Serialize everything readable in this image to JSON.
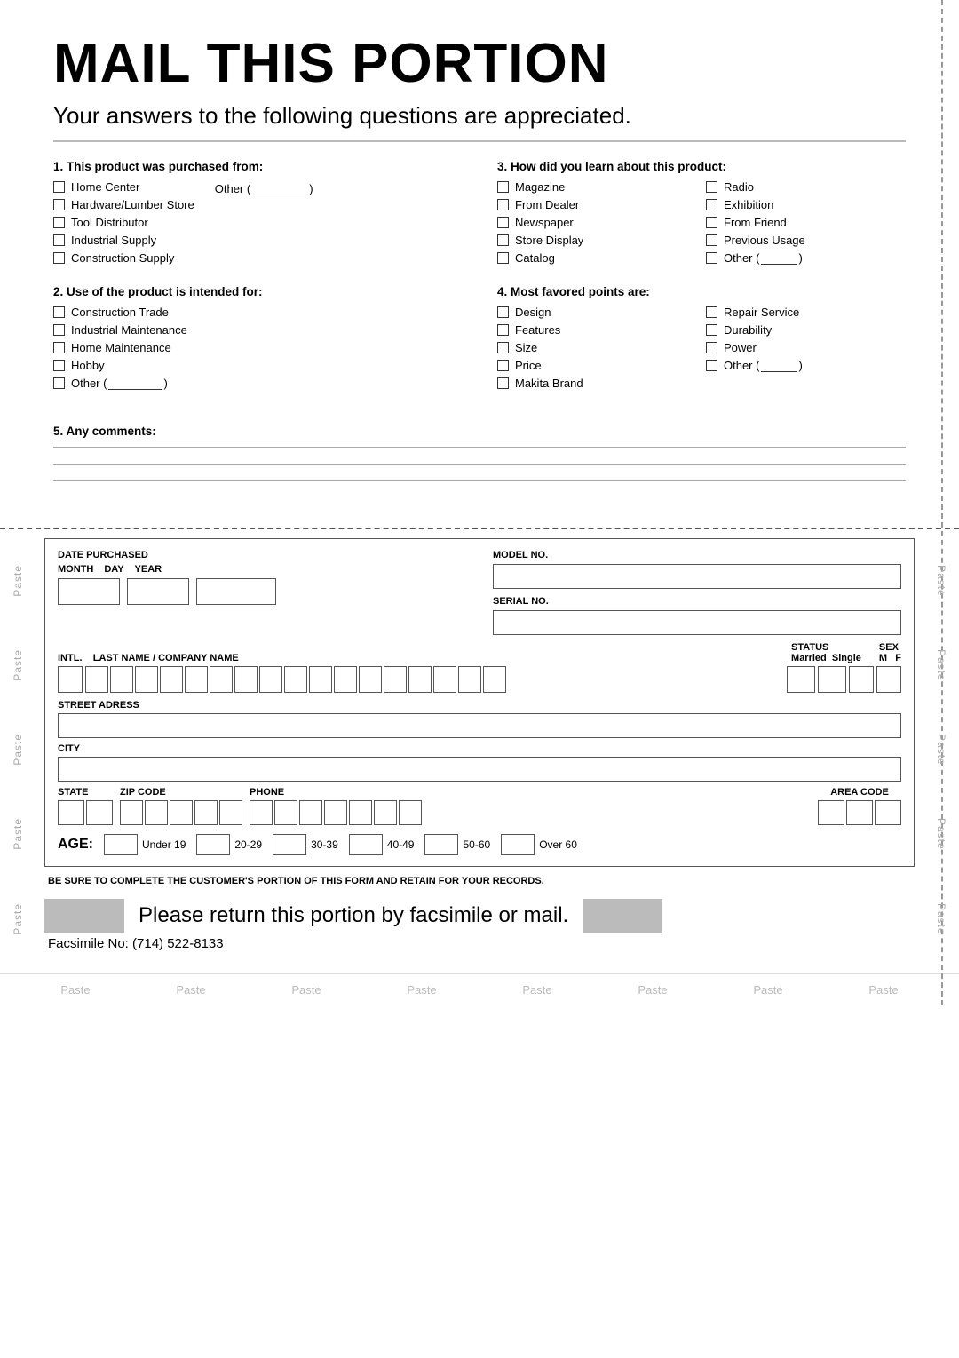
{
  "page": {
    "title": "MAIL THIS PORTION",
    "subtitle": "Your answers to the following questions are appreciated.",
    "q1": {
      "label": "1. This product was purchased from:",
      "items": [
        {
          "text": "Home Center"
        },
        {
          "text": "Hardware/Lumber Store"
        },
        {
          "text": "Tool Distributor"
        },
        {
          "text": "Industrial Supply"
        },
        {
          "text": "Construction Supply"
        }
      ],
      "other": "Other ("
    },
    "q2": {
      "label": "2. Use of the product is intended for:",
      "items": [
        {
          "text": "Construction Trade"
        },
        {
          "text": "Industrial Maintenance"
        },
        {
          "text": "Home Maintenance"
        },
        {
          "text": "Hobby"
        },
        {
          "text": "Other ("
        }
      ]
    },
    "q3": {
      "label": "3. How did you learn about this product:",
      "col1": [
        {
          "text": "Magazine"
        },
        {
          "text": "From Dealer"
        },
        {
          "text": "Newspaper"
        },
        {
          "text": "Store Display"
        },
        {
          "text": "Catalog"
        }
      ],
      "col2": [
        {
          "text": "Radio"
        },
        {
          "text": "Exhibition"
        },
        {
          "text": "From Friend"
        },
        {
          "text": "Previous Usage"
        },
        {
          "text": "Other ("
        }
      ]
    },
    "q4": {
      "label": "4. Most favored points are:",
      "col1": [
        {
          "text": "Design"
        },
        {
          "text": "Features"
        },
        {
          "text": "Size"
        },
        {
          "text": "Price"
        },
        {
          "text": "Makita Brand"
        }
      ],
      "col2": [
        {
          "text": "Repair Service"
        },
        {
          "text": "Durability"
        },
        {
          "text": "Power"
        },
        {
          "text": "Other ("
        }
      ]
    },
    "q5": {
      "label": "5. Any comments:"
    },
    "form": {
      "date_purchased": "DATE PURCHASED",
      "month": "MONTH",
      "day": "DAY",
      "year": "YEAR",
      "model_no": "MODEL NO.",
      "serial_no": "SERIAL NO.",
      "intl_label": "INTL.",
      "name_label": "LAST NAME / COMPANY NAME",
      "status_label": "STATUS",
      "married": "Married",
      "single": "Single",
      "sex_label": "SEX",
      "m": "M",
      "f": "F",
      "street": "STREET ADRESS",
      "city": "CITY",
      "state": "STATE",
      "zip": "ZIP CODE",
      "phone": "PHONE",
      "area_code": "AREA CODE",
      "age_label": "AGE:",
      "age_ranges": [
        "Under 19",
        "20-29",
        "30-39",
        "40-49",
        "50-60",
        "Over 60"
      ]
    },
    "footer": {
      "note": "BE SURE TO COMPLETE THE CUSTOMER'S PORTION OF THIS FORM AND RETAIN FOR YOUR RECORDS.",
      "return_text": "Please return this portion by facsimile or mail.",
      "fax": "Facsimile No: (714) 522-8133"
    },
    "paste_labels": [
      "Paste",
      "Paste",
      "Paste",
      "Paste",
      "Paste",
      "Paste",
      "Paste",
      "Paste"
    ],
    "paste_side": "Paste"
  }
}
